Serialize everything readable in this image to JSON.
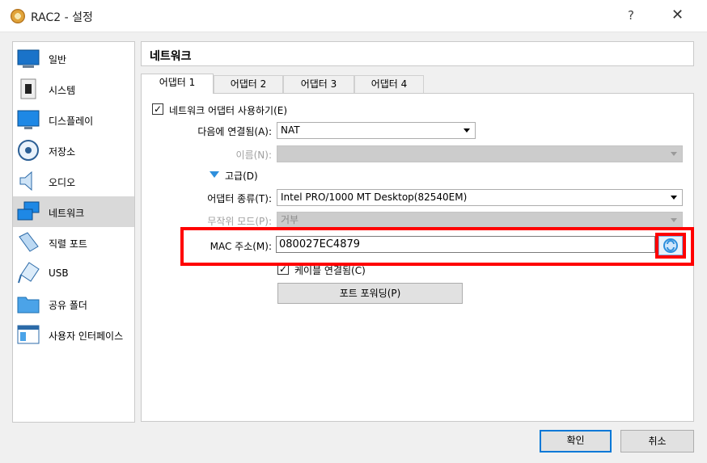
{
  "window": {
    "title": "RAC2 - 설정",
    "help": "?",
    "close": "✕"
  },
  "sidebar": {
    "items": [
      {
        "label": "일반",
        "icon": "general-icon"
      },
      {
        "label": "시스템",
        "icon": "system-icon"
      },
      {
        "label": "디스플레이",
        "icon": "display-icon"
      },
      {
        "label": "저장소",
        "icon": "storage-icon"
      },
      {
        "label": "오디오",
        "icon": "audio-icon"
      },
      {
        "label": "네트워크",
        "icon": "network-icon",
        "selected": true
      },
      {
        "label": "직렬 포트",
        "icon": "serial-port-icon"
      },
      {
        "label": "USB",
        "icon": "usb-icon"
      },
      {
        "label": "공유 폴더",
        "icon": "shared-folder-icon"
      },
      {
        "label": "사용자 인터페이스",
        "icon": "user-interface-icon"
      }
    ]
  },
  "main": {
    "header": "네트워크",
    "tabs": [
      "어댑터 1",
      "어댑터 2",
      "어댑터 3",
      "어댑터 4"
    ],
    "active_tab": 0,
    "enable_adapter": {
      "label": "네트워크 어댑터 사용하기(E)",
      "checked": true
    },
    "attached_to": {
      "label": "다음에 연결됨(A):",
      "value": "NAT"
    },
    "name": {
      "label": "이름(N):",
      "value": ""
    },
    "advanced": {
      "label": "고급(D)",
      "expanded": true
    },
    "adapter_type": {
      "label": "어댑터 종류(T):",
      "value": "Intel PRO/1000 MT Desktop(82540EM)"
    },
    "promiscuous": {
      "label": "무작위 모드(P):",
      "value": "거부"
    },
    "mac": {
      "label": "MAC 주소(M):",
      "value": "080027EC4879"
    },
    "cable": {
      "label": "케이블 연결됨(C)",
      "checked": true
    },
    "port_forwarding": "포트 포워딩(P)"
  },
  "footer": {
    "ok": "확인",
    "cancel": "취소"
  },
  "colors": {
    "highlight": "#ff0000",
    "accent": "#0078d7",
    "selected_item": "#d9d9d9"
  }
}
